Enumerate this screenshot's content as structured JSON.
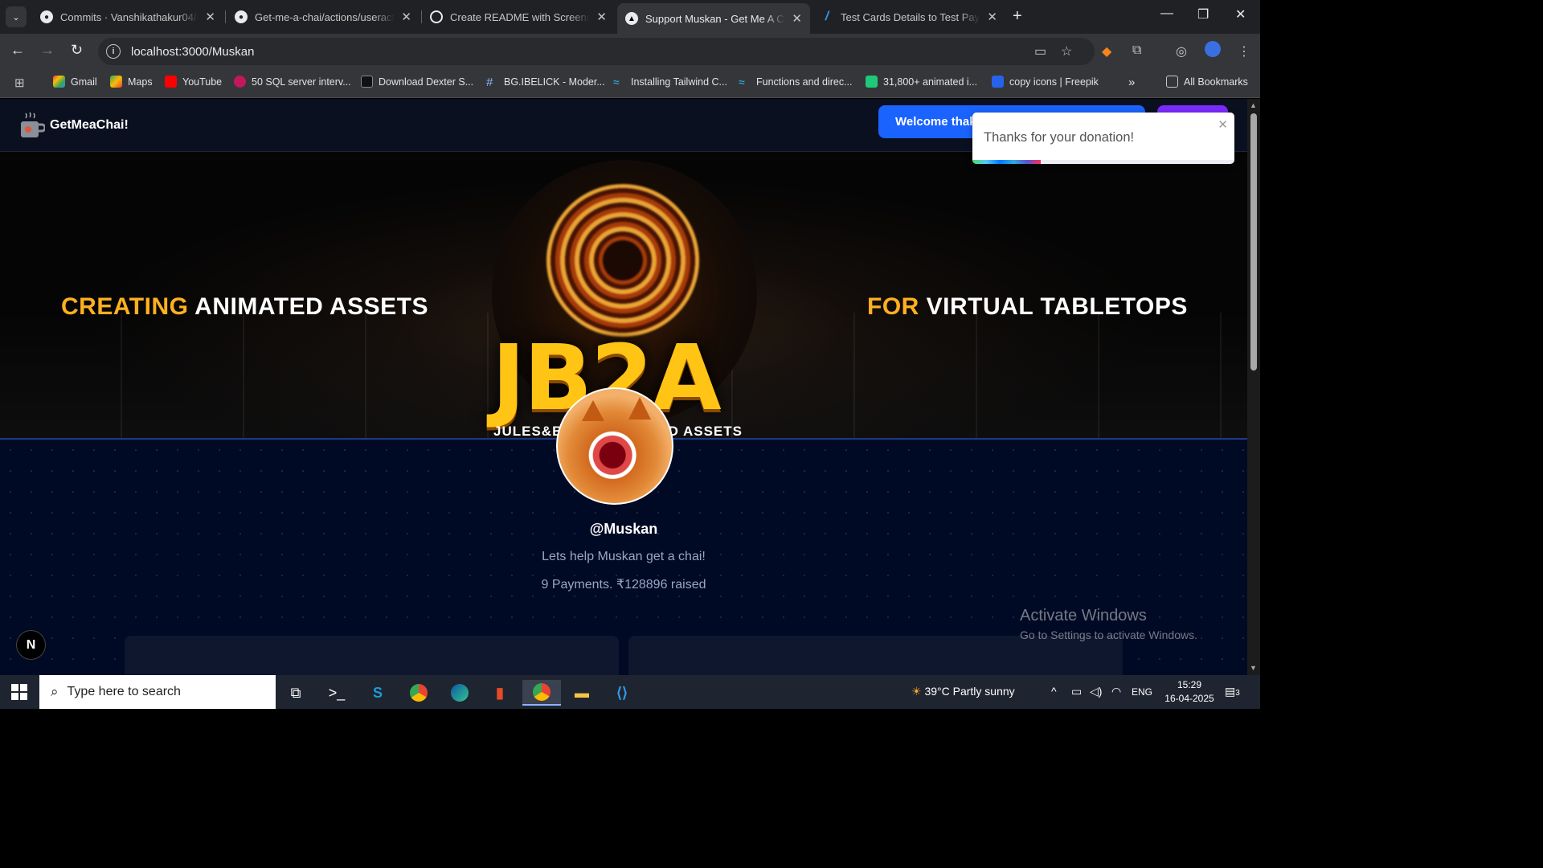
{
  "browser": {
    "tabs": [
      {
        "title": "Commits · Vanshikathakur04/Ge",
        "icon": "github-icon"
      },
      {
        "title": "Get-me-a-chai/actions/useracti",
        "icon": "github-icon"
      },
      {
        "title": "Create README with Screensho",
        "icon": "openai-icon"
      },
      {
        "title": "Support Muskan - Get Me A Ch",
        "icon": "vercel-icon",
        "active": true
      },
      {
        "title": "Test Cards Details to Test Payme",
        "icon": "razorpay-icon"
      }
    ],
    "url": "localhost:3000/Muskan",
    "bookmarks": [
      {
        "label": "Gmail"
      },
      {
        "label": "Maps"
      },
      {
        "label": "YouTube"
      },
      {
        "label": "50 SQL server interv..."
      },
      {
        "label": "Download Dexter S..."
      },
      {
        "label": "BG.IBELICK - Moder..."
      },
      {
        "label": "Installing Tailwind C..."
      },
      {
        "label": "Functions and direc..."
      },
      {
        "label": "31,800+ animated i..."
      },
      {
        "label": "copy icons | Freepik"
      }
    ],
    "all_bookmarks": "All Bookmarks"
  },
  "site": {
    "brand": "GetMeaChai!",
    "welcome_button": "Welcome thakurvanshika04@gmail.com",
    "banner": {
      "left_highlight": "CREATING",
      "left_rest": " ANIMATED ASSETS",
      "right_highlight": "FOR",
      "right_rest": " VIRTUAL TABLETOPS",
      "logo_text": "JB2A",
      "logo_sub": "JULES&BEN'S ANIMATED ASSETS"
    },
    "profile": {
      "username": "@Muskan",
      "description": "Lets help Muskan get a chai!",
      "stats": "9 Payments. ₹128896 raised"
    },
    "next_badge": "N"
  },
  "toast": {
    "message": "Thanks for your donation!",
    "progress": 0.26
  },
  "activate_windows": {
    "title": "Activate Windows",
    "subtitle": "Go to Settings to activate Windows."
  },
  "taskbar": {
    "search_placeholder": "Type here to search",
    "weather": "39°C  Partly sunny",
    "language": "ENG",
    "time": "15:29",
    "date": "16-04-2025",
    "notification_count": "3"
  }
}
